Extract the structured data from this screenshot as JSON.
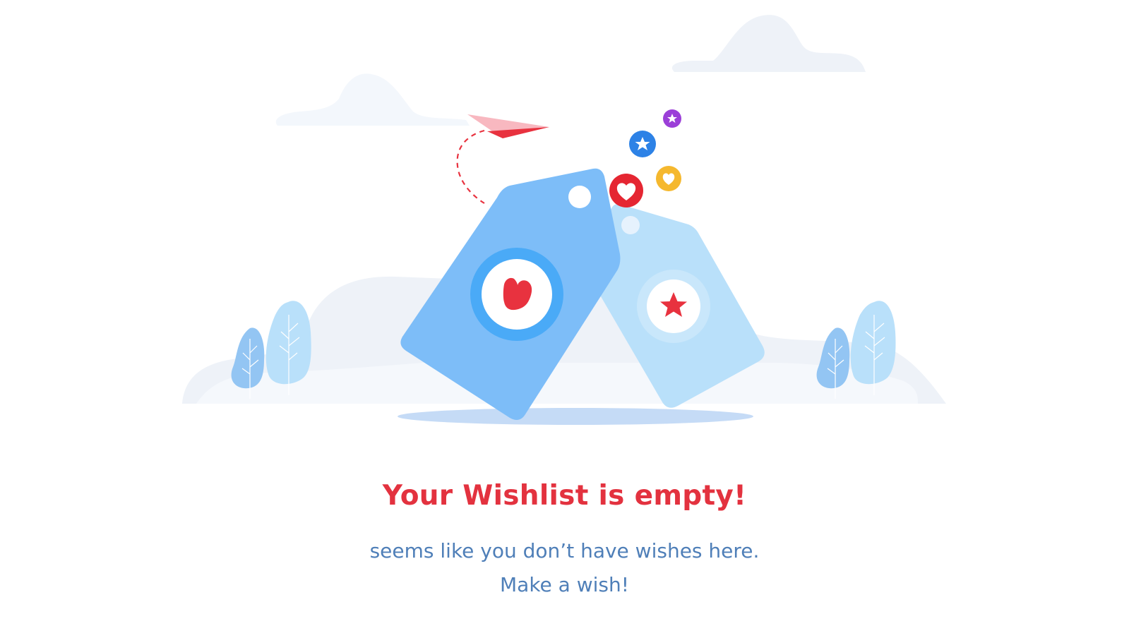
{
  "empty_state": {
    "title": "Your Wishlist is empty!",
    "message_line_1": "seems like you don’t have wishes here.",
    "message_line_2": "Make a wish!"
  },
  "colors": {
    "title": "#e3323f",
    "message": "#4f7fb8",
    "tag_front": "#7dbdf8",
    "tag_back": "#b9e0fa",
    "heart": "#e8323f",
    "cloud": "#eef2f8"
  },
  "icons": {
    "paper_plane": "paper-plane-icon",
    "front_tag_heart": "heart-icon",
    "back_tag_star": "star-icon",
    "floating": [
      "star-icon",
      "heart-icon",
      "star-icon",
      "heart-icon"
    ]
  }
}
